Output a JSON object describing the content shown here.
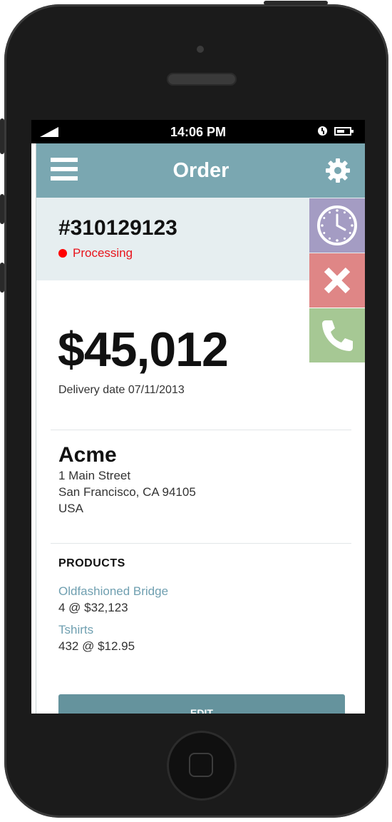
{
  "status_bar": {
    "time": "14:06 PM"
  },
  "navbar": {
    "title": "Order"
  },
  "order": {
    "number": "#310129123",
    "status": "Processing",
    "amount": "$45,012",
    "delivery": "Delivery date 07/11/2013"
  },
  "customer": {
    "name": "Acme",
    "address": [
      "1 Main Street",
      "San Francisco, CA 94105",
      "USA"
    ]
  },
  "products": {
    "title": "PRODUCTS",
    "items": [
      {
        "name": "Oldfashioned Bridge",
        "qty": "4 @ $32,123"
      },
      {
        "name": "Tshirts",
        "qty": "432 @ $12.95"
      }
    ]
  },
  "actions": {
    "edit_label": "EDIT"
  },
  "colors": {
    "nav": "#7aa7b1",
    "header_bg": "#e6eef0",
    "status_red": "#e8131b",
    "clock": "#a49cc3",
    "cancel": "#df8686",
    "call": "#a6c894",
    "link": "#6f9fb0"
  },
  "icons": [
    "menu-icon",
    "gear-icon",
    "clock-icon",
    "close-icon",
    "phone-icon",
    "signal-icon",
    "alarm-icon",
    "battery-icon"
  ]
}
